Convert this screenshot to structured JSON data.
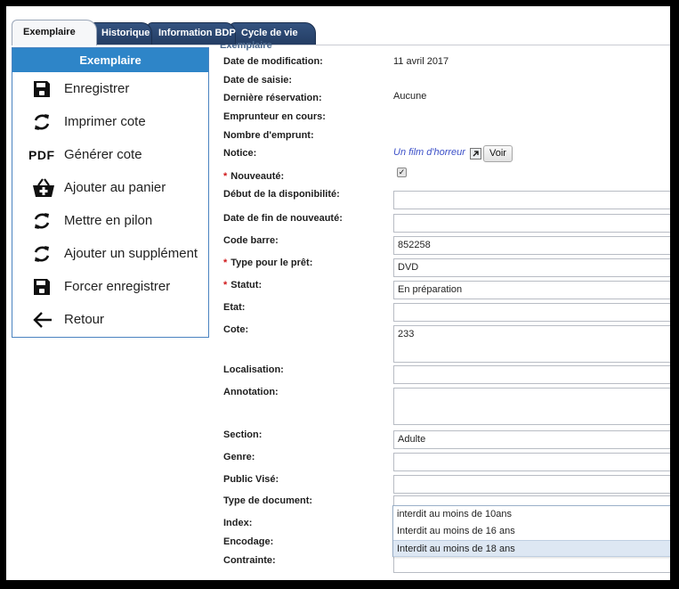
{
  "tabs": [
    {
      "label": "Exemplaire",
      "active": true
    },
    {
      "label": "Historique",
      "active": false
    },
    {
      "label": "Information BDP",
      "active": false
    },
    {
      "label": "Cycle de vie",
      "active": false
    }
  ],
  "sidebar": {
    "title": "Exemplaire",
    "items": [
      {
        "label": "Enregistrer",
        "icon": "save-icon"
      },
      {
        "label": "Imprimer cote",
        "icon": "refresh-icon"
      },
      {
        "label": "Générer cote",
        "icon": "pdf-icon",
        "icon_text": "PDF"
      },
      {
        "label": "Ajouter au panier",
        "icon": "basket-add-icon"
      },
      {
        "label": "Mettre en pilon",
        "icon": "refresh-icon"
      },
      {
        "label": "Ajouter un supplément",
        "icon": "refresh-icon"
      },
      {
        "label": "Forcer enregistrer",
        "icon": "save-icon"
      },
      {
        "label": "Retour",
        "icon": "arrow-left-icon"
      }
    ]
  },
  "form": {
    "section_title": "Exemplaire",
    "fields": {
      "date_modification": {
        "label": "Date de modification:",
        "value": "11 avril 2017"
      },
      "date_saisie": {
        "label": "Date de saisie:",
        "value": ""
      },
      "derniere_reservation": {
        "label": "Dernière réservation:",
        "value": "Aucune"
      },
      "emprunteur": {
        "label": "Emprunteur en cours:",
        "value": ""
      },
      "nombre_emprunt": {
        "label": "Nombre d'emprunt:",
        "value": ""
      },
      "notice": {
        "label": "Notice:",
        "value": "Un film d'horreur",
        "button": "Voir"
      },
      "nouveaute": {
        "label": "Nouveauté:",
        "checked": true
      },
      "debut_dispo": {
        "label": "Début de la disponibilité:",
        "value": ""
      },
      "fin_nouveaute": {
        "label": "Date de fin de nouveauté:",
        "value": ""
      },
      "code_barre": {
        "label": "Code barre:",
        "value": "852258"
      },
      "type_pret": {
        "label": "Type pour le prêt:",
        "value": "DVD"
      },
      "statut": {
        "label": "Statut:",
        "value": "En préparation"
      },
      "etat": {
        "label": "Etat:",
        "value": ""
      },
      "cote": {
        "label": "Cote:",
        "value": "233"
      },
      "localisation": {
        "label": "Localisation:",
        "value": ""
      },
      "annotation": {
        "label": "Annotation:",
        "value": ""
      },
      "section": {
        "label": "Section:",
        "value": "Adulte"
      },
      "genre": {
        "label": "Genre:",
        "value": ""
      },
      "public_vise": {
        "label": "Public Visé:",
        "value": ""
      },
      "type_document": {
        "label": "Type de document:",
        "value": ""
      },
      "index": {
        "label": "Index:",
        "value": ""
      },
      "encodage": {
        "label": "Encodage:",
        "value": ""
      },
      "contrainte": {
        "label": "Contrainte:",
        "value": ""
      }
    },
    "required_marker": "*",
    "dropdown_options": [
      {
        "label": "interdit au moins de 10ans",
        "selected": false
      },
      {
        "label": "Interdit au moins de 16 ans",
        "selected": false
      },
      {
        "label": "Interdit au moins de 18 ans",
        "selected": true
      }
    ]
  },
  "colors": {
    "tab_bg": "#2a4670",
    "sidebar_header": "#2e85c8",
    "required": "#d0191b",
    "link": "#3c50c8"
  }
}
